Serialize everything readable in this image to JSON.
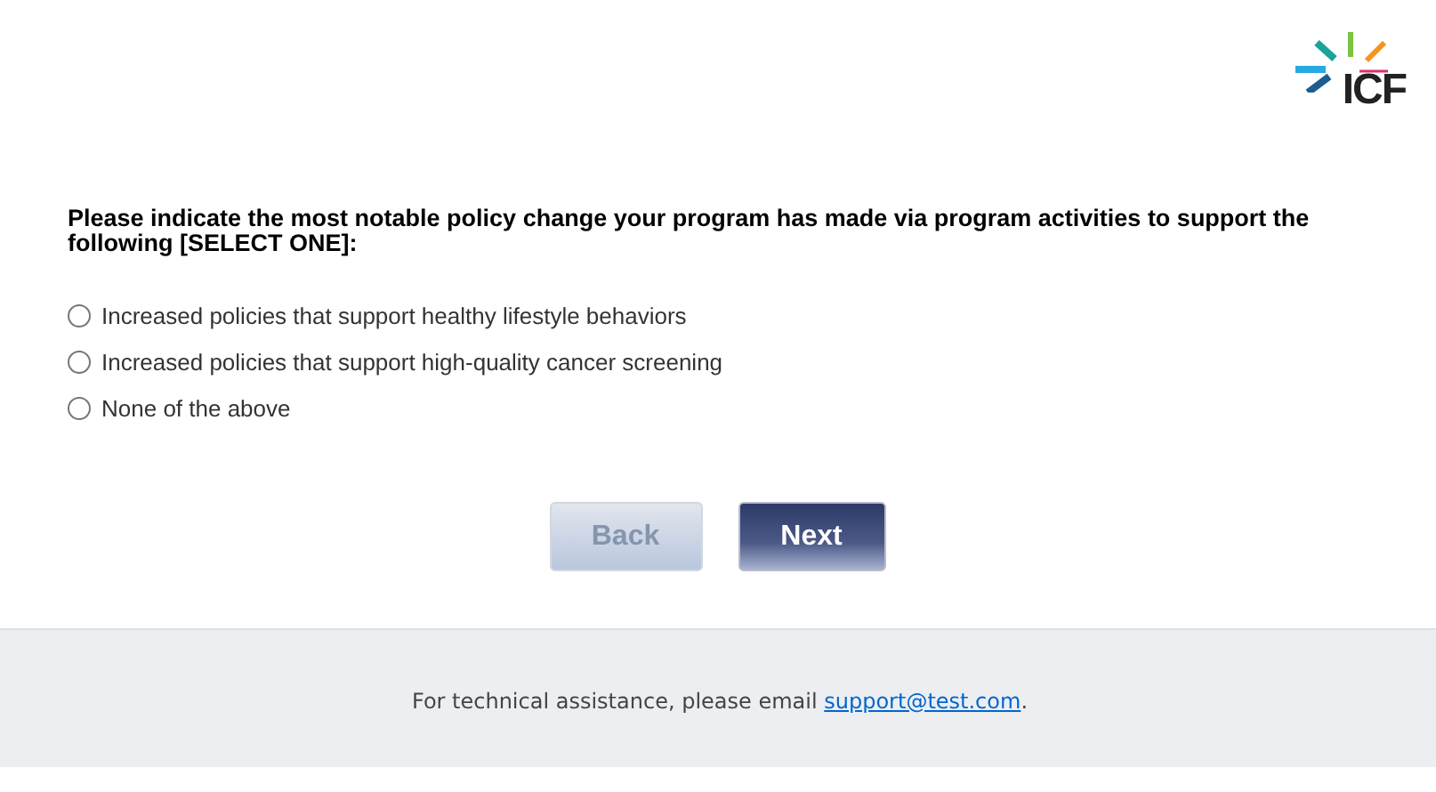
{
  "logo": {
    "text": "ICF"
  },
  "question": "Please indicate the most notable policy change your program has made via program activities to support the following [SELECT ONE]:",
  "options": [
    {
      "label": "Increased policies that support healthy lifestyle behaviors",
      "selected": false
    },
    {
      "label": "Increased policies that support high-quality cancer screening",
      "selected": false
    },
    {
      "label": "None of the above",
      "selected": false
    }
  ],
  "buttons": [
    {
      "label": "Back",
      "disabled": true
    },
    {
      "label": "Next",
      "disabled": false
    }
  ],
  "footer": {
    "text_before": "For technical assistance, please email ",
    "link": "support@test.com",
    "text_after": "."
  }
}
